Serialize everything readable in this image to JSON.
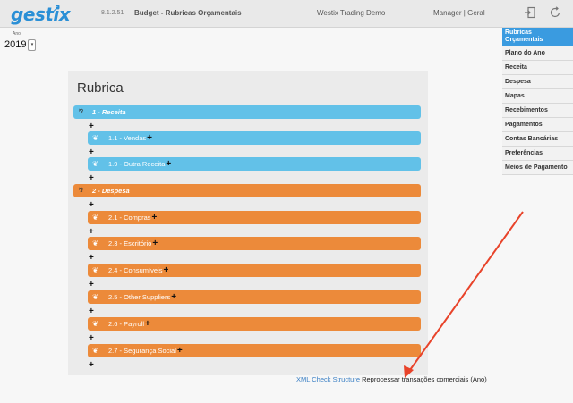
{
  "header": {
    "logo_text": "gestix",
    "version": "8.1.2.51",
    "page_title": "Budget - Rubricas Orçamentais",
    "company": "Westix Trading Demo",
    "user": "Manager | Geral"
  },
  "year": {
    "label": "Ano",
    "value": "2019"
  },
  "sidebar": {
    "items": [
      {
        "label": "Rubricas Orçamentais",
        "active": true
      },
      {
        "label": "Plano do Ano"
      },
      {
        "label": "Receita"
      },
      {
        "label": "Despesa"
      },
      {
        "label": "Mapas"
      },
      {
        "label": "Recebimentos"
      },
      {
        "label": "Pagamentos"
      },
      {
        "label": "Contas Bancárias"
      },
      {
        "label": "Preferências"
      },
      {
        "label": "Meios de Pagamento"
      }
    ]
  },
  "panel": {
    "title": "Rubrica",
    "receita": {
      "label": "1 - Receita",
      "children": [
        "1.1 - Vendas",
        "1.9 - Outra Receita"
      ]
    },
    "despesa": {
      "label": "2 - Despesa",
      "children": [
        "2.1 - Compras",
        "2.3 - Escritório",
        "2.4 - Consumíveis",
        "2.5 - Other Suppliers",
        "2.6 - Payroll",
        "2.7 - Segurança Social"
      ]
    },
    "plus_symbol": "+"
  },
  "footer": {
    "xml_check": "XML Check Structure",
    "reprocess": "Reprocessar transações comerciais (Ano)"
  },
  "colors": {
    "receita": "#62c1e8",
    "despesa": "#ec8a3a",
    "accent": "#3a9be0",
    "annotation_arrow": "#e8432a"
  }
}
